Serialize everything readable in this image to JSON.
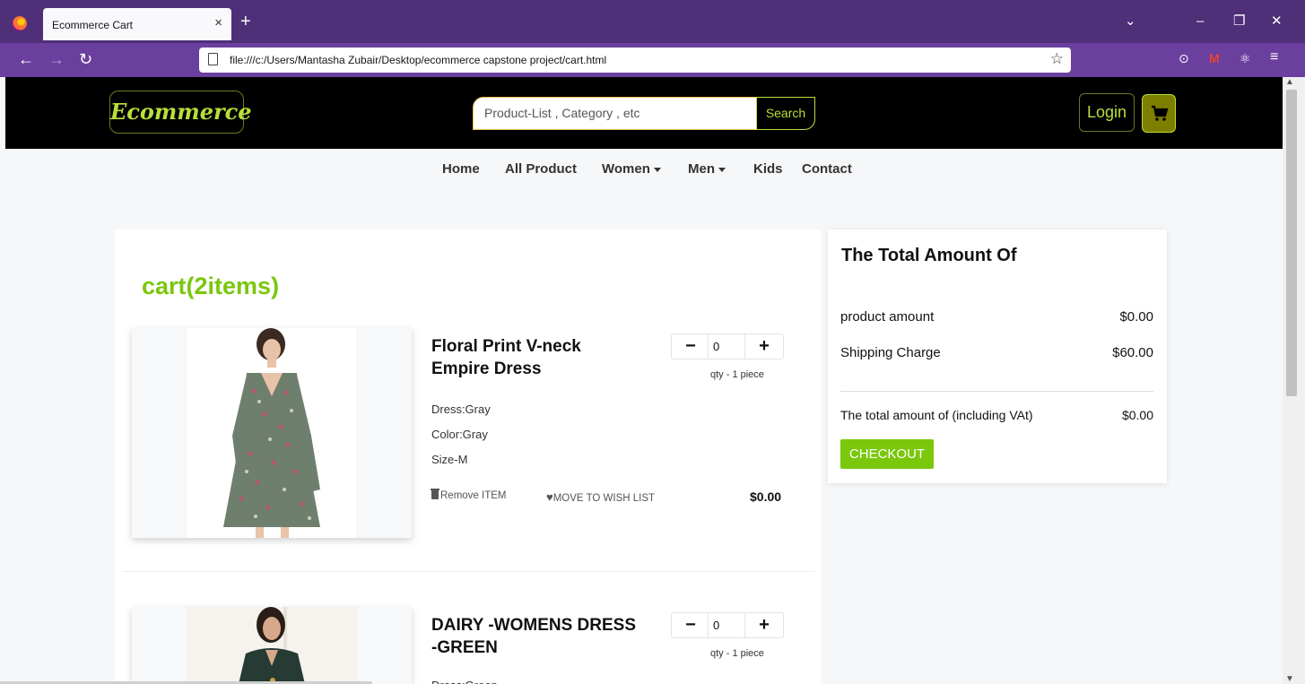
{
  "browser": {
    "tab_title": "Ecommerce Cart",
    "tab_close": "×",
    "new_tab": "+",
    "url": "file:///c:/Users/Mantasha Zubair/Desktop/ecommerce capstone project/cart.html",
    "controls": {
      "list": "⌄",
      "minimize": "–",
      "restore": "❐",
      "close": "✕"
    },
    "nav": {
      "back": "←",
      "forward": "→",
      "reload": "↻"
    },
    "star": "☆",
    "ext_pocket": "⊙",
    "ext_gmail": "M",
    "ext_react": "⚛",
    "menu": "≡"
  },
  "header": {
    "brand": "Ecommerce",
    "search_placeholder": "Product-List , Category , etc",
    "search_button": "Search",
    "login": "Login"
  },
  "menu": {
    "home": "Home",
    "all_product": "All Product",
    "women": "Women",
    "men": "Men",
    "kids": "Kids",
    "contact": "Contact"
  },
  "cart": {
    "heading": "cart(2items)",
    "items": [
      {
        "name": "Floral Print V-neck Empire Dress",
        "qty": "0",
        "qty_note": "qty - 1 piece",
        "dress": "Dress:Gray",
        "color": "Color:Gray",
        "size": "Size-M",
        "remove": "Remove ITEM",
        "wishlist": "MOVE TO WISH LIST",
        "price": "$0.00"
      },
      {
        "name": "DAIRY -WOMENS DRESS -GREEN",
        "qty": "0",
        "qty_note": "qty - 1 piece",
        "dress": "Dress:Green"
      }
    ],
    "minus": "−",
    "plus": "+"
  },
  "summary": {
    "title": "The Total Amount Of",
    "product_amount_label": "product amount",
    "product_amount": "$0.00",
    "shipping_label": "Shipping Charge",
    "shipping": "$60.00",
    "total_label": "The total amount of (including VAt)",
    "total": "$0.00",
    "checkout": "CHECKOUT"
  },
  "colors": {
    "accent_green": "#7ac70c",
    "brand_green": "#b9df3c",
    "browser_purple": "#4e2f78",
    "header_black": "#000000"
  }
}
